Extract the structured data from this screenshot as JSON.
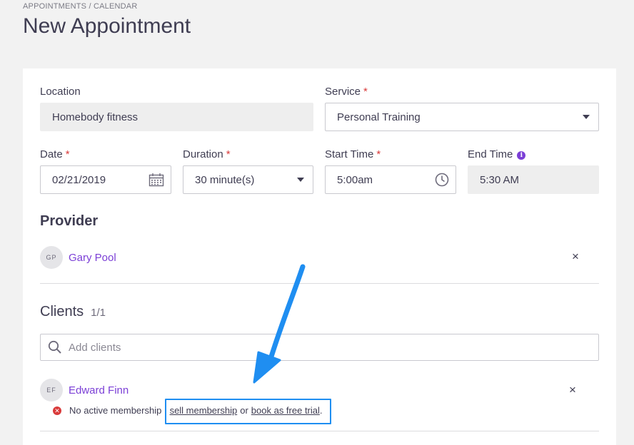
{
  "header": {
    "breadcrumb": "APPOINTMENTS / CALENDAR",
    "title": "New Appointment"
  },
  "form": {
    "location": {
      "label": "Location",
      "value": "Homebody fitness"
    },
    "service": {
      "label": "Service",
      "required_mark": "*",
      "value": "Personal Training"
    },
    "date": {
      "label": "Date",
      "required_mark": "*",
      "value": "02/21/2019"
    },
    "duration": {
      "label": "Duration",
      "required_mark": "*",
      "value": "30 minute(s)"
    },
    "start_time": {
      "label": "Start Time",
      "required_mark": "*",
      "value": "5:00am"
    },
    "end_time": {
      "label": "End Time",
      "info_icon": "i",
      "value": "5:30 AM"
    }
  },
  "provider": {
    "title": "Provider",
    "initials": "GP",
    "name": "Gary Pool",
    "remove_label": "×"
  },
  "clients": {
    "title": "Clients",
    "count": "1/1",
    "search_placeholder": "Add clients",
    "list": [
      {
        "initials": "EF",
        "name": "Edward Finn",
        "remove_label": "×",
        "warning_text": "No active membership :",
        "sell_link": "sell membership",
        "or_text": "or",
        "trial_link": "book as free trial",
        "period": "."
      }
    ]
  },
  "colors": {
    "accent_purple": "#7b3fd6",
    "required_red": "#d93a3a",
    "annotation_blue": "#1f8ef1"
  },
  "icons": {
    "calendar": "calendar-icon",
    "clock": "clock-icon",
    "search": "search-icon",
    "info": "info-icon",
    "error": "error-icon",
    "caret": "chevron-down-icon",
    "close": "close-icon"
  }
}
